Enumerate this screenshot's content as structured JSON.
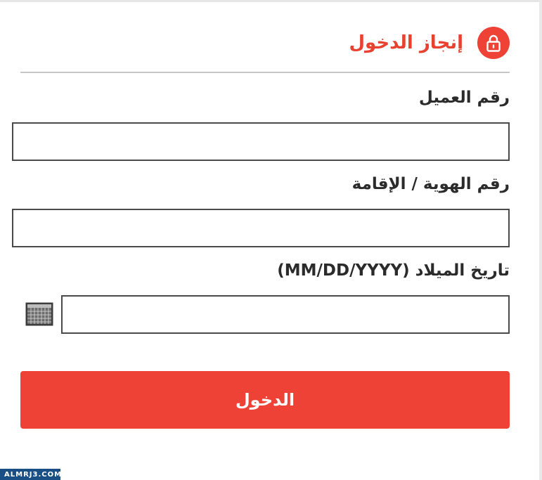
{
  "header": {
    "title": "إنجاز الدخول",
    "icon": "lock-icon"
  },
  "form": {
    "customer_number": {
      "label": "رقم العميل",
      "value": "",
      "placeholder": ""
    },
    "id_number": {
      "label": "رقم الهوية / الإقامة",
      "value": "",
      "placeholder": ""
    },
    "birth_date": {
      "label": "تاريخ الميلاد (MM/DD/YYYY)",
      "value": "",
      "placeholder": "",
      "icon": "calendar-icon"
    }
  },
  "submit_label": "الدخول",
  "watermark": "ALMRJ3.COM",
  "colors": {
    "accent": "#ef4236",
    "title": "#e8412f",
    "text": "#2b2b2b"
  }
}
